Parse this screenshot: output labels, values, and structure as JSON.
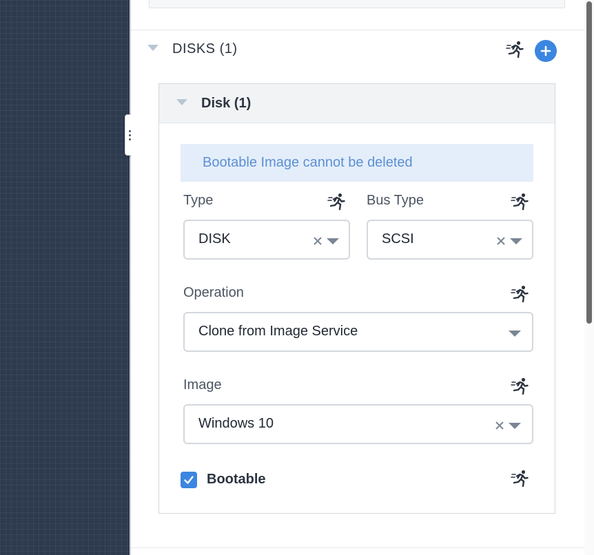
{
  "section": {
    "title": "DISKS (1)"
  },
  "disk": {
    "title": "Disk (1)",
    "banner": "Bootable Image cannot be deleted",
    "type": {
      "label": "Type",
      "value": "DISK"
    },
    "bus_type": {
      "label": "Bus Type",
      "value": "SCSI"
    },
    "operation": {
      "label": "Operation",
      "value": "Clone from Image Service"
    },
    "image": {
      "label": "Image",
      "value": "Windows 10"
    },
    "bootable": {
      "label": "Bootable",
      "checked": true
    }
  },
  "icons": {
    "runtime": "runner-icon",
    "add": "plus-icon",
    "collapse": "triangle-down-icon",
    "clear": "close-icon",
    "dropdown": "caret-down-icon",
    "check": "checkmark-icon"
  },
  "colors": {
    "accent": "#3b86e0",
    "canvas": "#2e3b4e",
    "banner_bg": "#e4eefa",
    "banner_text": "#5d8fd4"
  }
}
